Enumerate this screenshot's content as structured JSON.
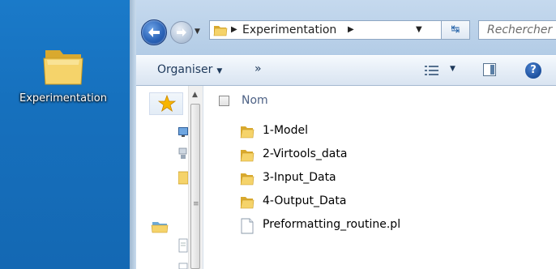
{
  "desktop": {
    "icon_label": "Experimentation",
    "icon": "folder-icon",
    "background_color": "#1670bd"
  },
  "window": {
    "address": {
      "breadcrumb": [
        "Experimentation"
      ],
      "icon": "folder-icon"
    },
    "search": {
      "placeholder": "Rechercher"
    },
    "toolbar": {
      "organize_label": "Organiser",
      "more_label": "»",
      "icons": [
        "views-icon",
        "preview-pane-icon",
        "help-icon"
      ]
    },
    "file_list": {
      "column_header": "Nom",
      "items": [
        {
          "name": "1-Model",
          "type": "folder"
        },
        {
          "name": "2-Virtools_data",
          "type": "folder"
        },
        {
          "name": "3-Input_Data",
          "type": "folder"
        },
        {
          "name": "4-Output_Data",
          "type": "folder"
        },
        {
          "name": "Preformatting_routine.pl",
          "type": "file"
        }
      ]
    }
  },
  "colors": {
    "titlebar": "#bdd3ea",
    "toolbar": "#e6eef7",
    "folder": "#f2c94c",
    "header_text": "#4d6185"
  }
}
